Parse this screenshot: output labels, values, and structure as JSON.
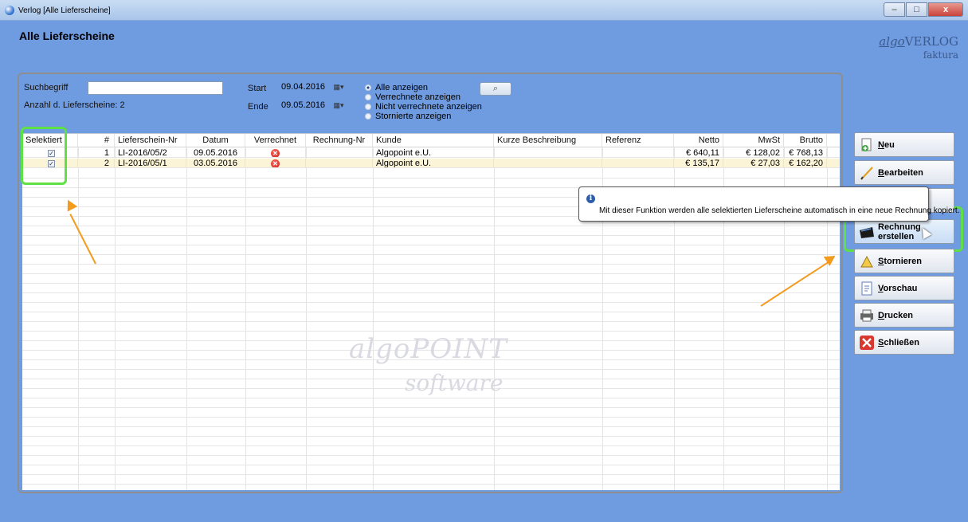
{
  "window": {
    "title": "Verlog [Alle Lieferscheine]",
    "controls": {
      "minimize": "–",
      "maximize": "□",
      "close": "x"
    }
  },
  "page_title": "Alle Lieferscheine",
  "logo": {
    "brand_italic": "algo",
    "brand_rest": "VERLOG",
    "sub": "faktura"
  },
  "filters": {
    "search_label": "Suchbegriff",
    "search_value": "",
    "count_text": "Anzahl d. Lieferscheine: 2",
    "start_label": "Start",
    "start_value": "09.04.2016",
    "end_label": "Ende",
    "end_value": "09.05.2016",
    "radios": [
      {
        "label": "Alle anzeigen",
        "checked": true
      },
      {
        "label": "Verrechnete anzeigen",
        "checked": false
      },
      {
        "label": "Nicht verrechnete anzeigen",
        "checked": false
      },
      {
        "label": "Stornierte anzeigen",
        "checked": false
      }
    ],
    "search_icon": "magnifier-icon"
  },
  "table": {
    "headers": [
      "Selektiert",
      "#",
      "Lieferschein-Nr",
      "Datum",
      "Verrechnet",
      "Rechnung-Nr",
      "Kunde",
      "Kurze Beschreibung",
      "Referenz",
      "Netto",
      "MwSt",
      "Brutto"
    ],
    "rows": [
      {
        "selected": true,
        "num": "1",
        "nr": "LI-2016/05/2",
        "datum": "09.05.2016",
        "verrechnet": "red-x-icon",
        "rechnung": "",
        "kunde": "Algopoint e.U.",
        "beschreibung": "",
        "referenz": "",
        "netto": "€ 640,11",
        "mwst": "€ 128,02",
        "brutto": "€ 768,13"
      },
      {
        "selected": true,
        "num": "2",
        "nr": "LI-2016/05/1",
        "datum": "03.05.2016",
        "verrechnet": "red-x-icon",
        "rechnung": "",
        "kunde": "Algopoint e.U.",
        "beschreibung": "",
        "referenz": "",
        "netto": "€ 135,17",
        "mwst": "€ 27,03",
        "brutto": "€ 162,20"
      }
    ]
  },
  "watermark": {
    "line1": "algoPOINT",
    "line2": "software"
  },
  "buttons": [
    {
      "key": "neu",
      "accel": "N",
      "rest": "eu",
      "icon": "new-doc-icon"
    },
    {
      "key": "bearbeiten",
      "accel": "B",
      "rest": "earbeiten",
      "icon": "pencil-icon"
    },
    {
      "key": "hidden",
      "accel": "",
      "rest": "",
      "icon": ""
    },
    {
      "key": "rechnung",
      "line1": "Rechnung",
      "line2": "erstellen",
      "icon": "invoice-icon"
    },
    {
      "key": "stornieren",
      "accel": "S",
      "rest": "tornieren",
      "icon": "cancel-doc-icon"
    },
    {
      "key": "vorschau",
      "accel": "V",
      "rest": "orschau",
      "icon": "preview-icon"
    },
    {
      "key": "drucken",
      "accel": "D",
      "rest": "rucken",
      "icon": "printer-icon"
    },
    {
      "key": "schliessen",
      "accel": "S",
      "rest": "chließen",
      "icon": "close-icon"
    }
  ],
  "tooltip": {
    "icon": "info-icon",
    "text": "Mit dieser Funktion werden alle selektierten Lieferscheine automatisch in eine neue Rechnung kopiert."
  },
  "colors": {
    "background": "#6f9be0",
    "highlight": "#5fe044",
    "arrow": "#f39b1f",
    "selected_row": "#fcf4d6"
  }
}
